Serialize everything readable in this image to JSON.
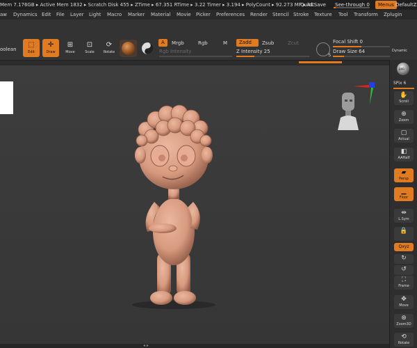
{
  "status": {
    "stats": "Mem 7.176GB ▸ Active Mem 1832 ▸ Scratch Disk 455 ▸ ZTime ▸ 67.351 RTime ▸ 3.22 Timer ▸ 3.194 ▸ PolyCount ▸ 92.273 MP ▸ AC",
    "quicksave": "QuickSave",
    "see_through_label": "See-through",
    "see_through_value": "0",
    "see_through_fraction": 0.05,
    "menus": "Menus",
    "default_script": "DefaultZS"
  },
  "menubar": {
    "items": [
      "aw",
      "Dynamics",
      "Edit",
      "File",
      "Layer",
      "Light",
      "Macro",
      "Marker",
      "Material",
      "Movie",
      "Picker",
      "Preferences",
      "Render",
      "Stencil",
      "Stroke",
      "Texture",
      "Tool",
      "Transform",
      "Zplugin"
    ]
  },
  "toolbar": {
    "boolean": "oolean",
    "edit": "Edit",
    "draw": "Draw",
    "move": "Move",
    "scale": "Scale",
    "rotate": "Rotate",
    "a": "A",
    "mrgb": "Mrgb",
    "rgb": "Rgb",
    "m": "M",
    "rgb_intensity": "Rgb Intensity",
    "zadd": "Zadd",
    "zsub": "Zsub",
    "zcut": "Zcut",
    "z_intensity_label": "Z Intensity",
    "z_intensity_value": "25",
    "z_intensity_fraction": 0.25,
    "focal_shift_label": "Focal Shift",
    "focal_shift_value": "0",
    "focal_shift_fraction": 0.5,
    "draw_size_label": "Draw Size",
    "draw_size_value": "64",
    "draw_size_fraction": 0.2,
    "dynamic": "Dynamic",
    "s_label": "S"
  },
  "shelf": {
    "bpr": "BPR",
    "spix_label": "SPix",
    "spix_value": "6",
    "scroll": "Scroll",
    "zoom": "Zoom",
    "actual": "Actual",
    "aahalf": "AAHalf",
    "persp": "Persp",
    "floor": "Floor",
    "lsym": "L.Sym",
    "lock": "",
    "qxyz": "Qxyz",
    "frame": "Frame",
    "move": "Move",
    "zoom3d": "Zoom3D",
    "rotate": "Rotate"
  },
  "colors": {
    "accent": "#e07b22",
    "axis_red": "#e0231f",
    "axis_green": "#2ec22e",
    "axis_blue": "#2340e0",
    "model_skin": "#d79a7f"
  },
  "icons": [
    "edit-icon",
    "draw-icon",
    "move-icon",
    "scale-icon",
    "rotate-icon",
    "material-sphere-icon",
    "head-navigator-icon",
    "axis-gizmo-icon"
  ]
}
